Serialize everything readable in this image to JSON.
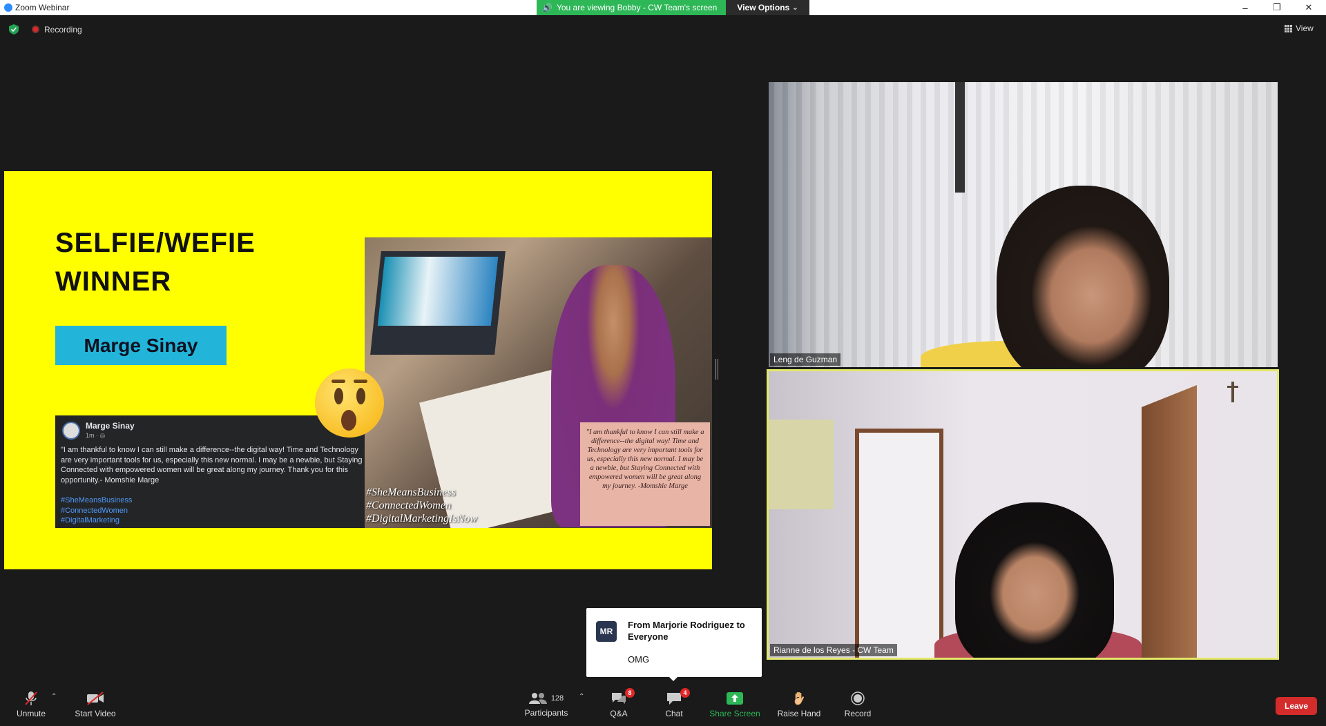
{
  "window": {
    "app_title": "Zoom Webinar",
    "banner_text": "You are viewing Bobby - CW Team's screen",
    "view_options_label": "View Options",
    "minimize": "–",
    "maximize": "❐",
    "close": "✕"
  },
  "status": {
    "recording_label": "Recording",
    "view_label": "View"
  },
  "slide": {
    "title_line1": "SELFIE/WEFIE",
    "title_line2": "WINNER",
    "winner_name": "Marge Sinay",
    "post": {
      "author": "Marge Sinay",
      "meta": "1m · ◎",
      "body": "\"I  am thankful to know I can still make a difference--the digital way! Time and Technology are very important tools for us, especially this new normal. I may be a newbie, but Staying Connected with empowered women will be great along my journey. Thank you for this opportunity.- Momshie Marge",
      "tags": [
        "#SheMeansBusiness",
        "#ConnectedWomen",
        " #DigitalMarketing"
      ]
    },
    "quote_card": "\"I  am thankful to know I can still make a difference--the digital way! Time and Technology are very important tools for us, especially this new normal. I may be a newbie, but Staying Connected with empowered women will be great along my journey. -Momshie Marge",
    "photo_hashtags": [
      "#SheMeansBusiness",
      "#ConnectedWomen",
      "#DigitalMarketingIsNow"
    ]
  },
  "participants_video": [
    {
      "name": "Leng de Guzman"
    },
    {
      "name": "Rianne de los Reyes - CW Team"
    }
  ],
  "chat_toast": {
    "initials": "MR",
    "from": "From Marjorie Rodriguez to Everyone",
    "message": "OMG"
  },
  "toolbar": {
    "unmute": "Unmute",
    "start_video": "Start Video",
    "participants": "Participants",
    "participants_count": "128",
    "qa": "Q&A",
    "qa_badge": "8",
    "chat": "Chat",
    "chat_badge": "4",
    "share_screen": "Share Screen",
    "raise_hand": "Raise Hand",
    "record": "Record",
    "leave": "Leave"
  },
  "colors": {
    "banner_green": "#2db757",
    "leave_red": "#d42b2b",
    "slide_yellow": "#ffff00",
    "active_speaker_border": "#e3e86a"
  }
}
